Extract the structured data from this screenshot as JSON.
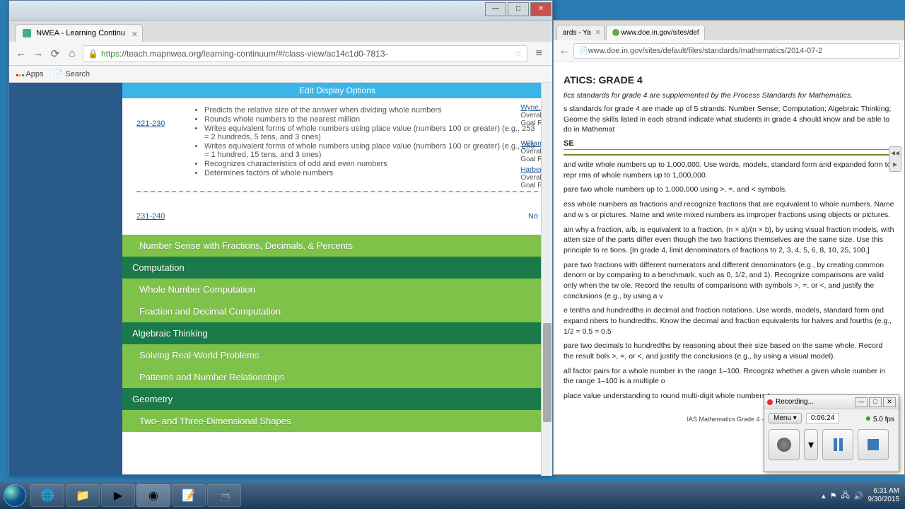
{
  "window1": {
    "tab_title": "NWEA - Learning Continu",
    "url_prefix": "https",
    "url_rest": "://teach.mapnwea.org/learning-continuum/#/class-view/ac14c1d0-7813-",
    "bookmarks": {
      "apps": "Apps",
      "search": "Search"
    },
    "edit_display": "Edit Display Options",
    "students": [
      {
        "name": "Wyne,",
        "l1": "Overall",
        "l2": "Goal Ra"
      },
      {
        "name": "William",
        "l1": "Overall",
        "l2": "Goal Ra"
      },
      {
        "name": "Harber",
        "l1": "Overall",
        "l2": "Goal Ra"
      }
    ],
    "rit1": {
      "range": "221-230",
      "bullets": [
        "Predicts the relative size of the answer when dividing whole numbers",
        "Rounds whole numbers to the nearest million",
        "Writes equivalent forms of whole numbers using place value (numbers 100 or greater) (e.g., 253 = 2 hundreds, 5 tens, and 3 ones)",
        "Writes equivalent forms of whole numbers using place value (numbers 100 or greater) (e.g., 253 = 1 hundred, 15 tens, and 3 ones)",
        "Recognizes characteristics of odd and even numbers",
        "Determines factors of whole numbers"
      ]
    },
    "rit2": {
      "range": "231-240",
      "note": "No"
    },
    "cats": [
      {
        "cls": "cat-sub",
        "label": "Number Sense with Fractions, Decimals, & Percents"
      },
      {
        "cls": "cat-main",
        "label": "Computation"
      },
      {
        "cls": "cat-sub",
        "label": "Whole Number Computation"
      },
      {
        "cls": "cat-sub",
        "label": "Fraction and Decimal Computation"
      },
      {
        "cls": "cat-main",
        "label": "Algebraic Thinking"
      },
      {
        "cls": "cat-sub",
        "label": "Solving Real-World Problems"
      },
      {
        "cls": "cat-sub",
        "label": "Patterns and Number Relationships"
      },
      {
        "cls": "cat-main",
        "label": "Geometry"
      },
      {
        "cls": "cat-sub",
        "label": "Two- and Three-Dimensional Shapes"
      }
    ]
  },
  "window2": {
    "tabs": [
      "ards - Ya",
      "www.doe.in.gov/sites/def"
    ],
    "url": "www.doe.in.gov/sites/default/files/standards/mathematics/2014-07-2",
    "heading": "ATICS: GRADE 4",
    "intro_i": "tics standards for grade 4 are supplemented by the Process Standards for Mathematics.",
    "intro_p": "s standards for grade 4 are made up of 5 strands: Number Sense; Computation; Algebraic Thinking; Geome the skills listed in each strand indicate what students in grade 4 should know and be able to do in Mathemat",
    "sub": "SE",
    "rows": [
      "and write whole numbers up to 1,000,000.  Use words, models, standard form and expanded form to repr rms of whole numbers up to 1,000,000.",
      "pare two whole numbers up to 1,000,000 using >, =, and < symbols.",
      "ess whole numbers as fractions and recognize fractions that are equivalent to whole numbers.  Name and w s or pictures.  Name and write mixed numbers as improper fractions using objects or pictures.",
      "ain why a fraction, a/b, is equivalent to a fraction, (n × a)/(n × b), by using visual fraction models, with atten size of the parts differ even though the two fractions themselves are the same size.  Use this principle to re tions.  [In grade 4, limit denominators of fractions to 2, 3, 4, 5, 6, 8, 10, 25, 100.]",
      "pare two fractions with different numerators and different denominators (e.g., by creating common denom or by comparing to a benchmark, such as 0, 1/2, and 1).  Recognize comparisons are valid only when the tw ole.  Record the results of comparisons with symbols >, =, or <, and justify the conclusions (e.g., by using a v",
      "e tenths and hundredths in decimal and fraction notations.  Use words, models, standard form and expand nbers to hundredths.  Know the decimal and fraction equivalents for halves and fourths (e.g., 1/2 = 0.5 = 0.5",
      "pare two decimals to hundredths by reasoning about their size based on the same whole.  Record the result bols >, =, or <, and justify the conclusions (e.g., by using a visual model).",
      "all factor pairs for a whole number in the range 1–100.  Recogniz whether a given whole number in the range 1–100 is a multiple o",
      "place value understanding to round multi-digit whole numbers t"
    ],
    "footer": "IAS Mathematics Grade 4 – P"
  },
  "recorder": {
    "title": "Recording...",
    "menu": "Menu",
    "time": "0:06:24",
    "fps": "5.0 fps"
  },
  "taskbar": {
    "time": "6:31 AM",
    "date": "9/30/2015"
  }
}
